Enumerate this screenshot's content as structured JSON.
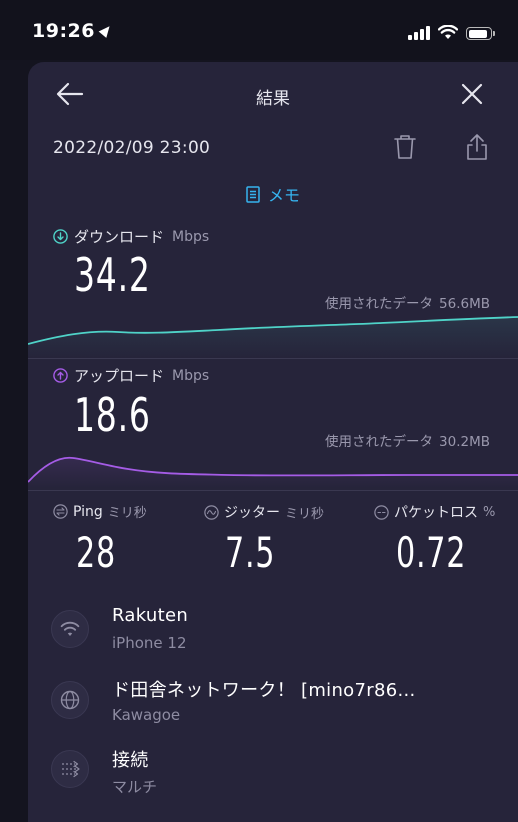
{
  "status": {
    "time": "19:26"
  },
  "header": {
    "title": "結果",
    "date": "2022/02/09 23:00",
    "memo_label": "メモ"
  },
  "download": {
    "label": "ダウンロード",
    "unit": "Mbps",
    "value": "34.2",
    "used_label": "使用されたデータ",
    "used_value": "56.6MB",
    "color": "#4fd3c8"
  },
  "upload": {
    "label": "アップロード",
    "unit": "Mbps",
    "value": "18.6",
    "used_label": "使用されたデータ",
    "used_value": "30.2MB",
    "color": "#a55ce6"
  },
  "stats": {
    "ping": {
      "label": "Ping",
      "unit": "ミリ秒",
      "value": "28"
    },
    "jitter": {
      "label": "ジッター",
      "unit": "ミリ秒",
      "value": "7.5"
    },
    "loss": {
      "label": "パケットロス",
      "unit": "%",
      "value": "0.72"
    }
  },
  "info": {
    "provider": {
      "title": "Rakuten",
      "sub": "iPhone 12"
    },
    "server": {
      "title": "ド田舎ネットワーク！ [mino7r86...",
      "sub": "Kawagoe"
    },
    "connection": {
      "title": "接続",
      "sub": "マルチ"
    }
  },
  "icons": {
    "back": "arrow-left-icon",
    "close": "close-icon",
    "trash": "trash-icon",
    "share": "share-icon",
    "memo": "memo-icon",
    "wifi": "wifi-icon",
    "globe": "globe-icon",
    "connections": "connections-icon"
  },
  "colors": {
    "background": "#26243a",
    "accent": "#36b4f0"
  }
}
